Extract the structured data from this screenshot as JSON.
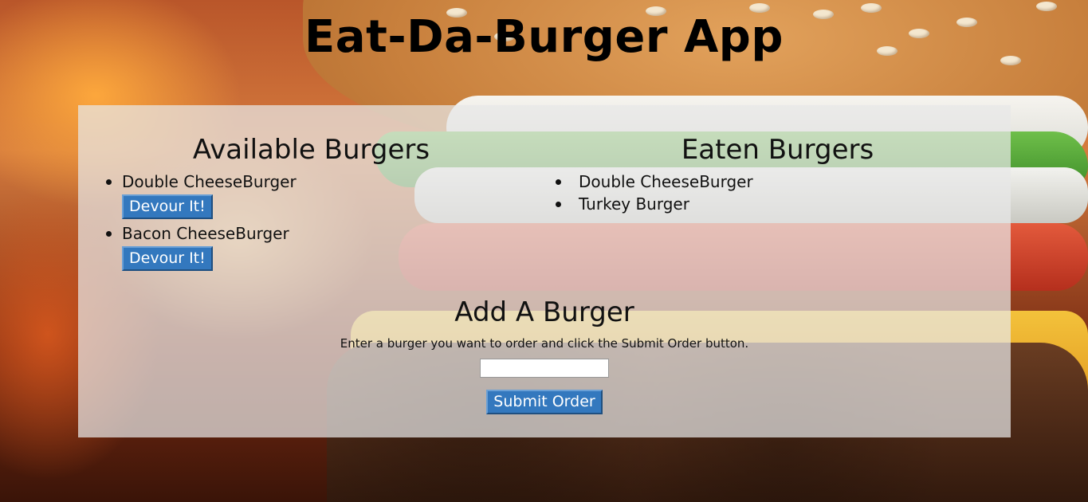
{
  "page": {
    "title": "Eat-Da-Burger App"
  },
  "available": {
    "heading": "Available Burgers",
    "items": [
      {
        "name": "Double CheeseBurger",
        "button_label": "Devour It!"
      },
      {
        "name": "Bacon CheeseBurger",
        "button_label": "Devour It!"
      }
    ]
  },
  "eaten": {
    "heading": "Eaten Burgers",
    "items": [
      {
        "name": "Double CheeseBurger"
      },
      {
        "name": "Turkey Burger"
      }
    ]
  },
  "add": {
    "heading": "Add A Burger",
    "instructions": "Enter a burger you want to order and click the Submit Order button.",
    "input_value": "",
    "submit_label": "Submit Order"
  },
  "colors": {
    "button_bg": "#3378be",
    "button_text": "#ffffff",
    "panel_bg": "rgba(232,232,232,0.72)"
  }
}
